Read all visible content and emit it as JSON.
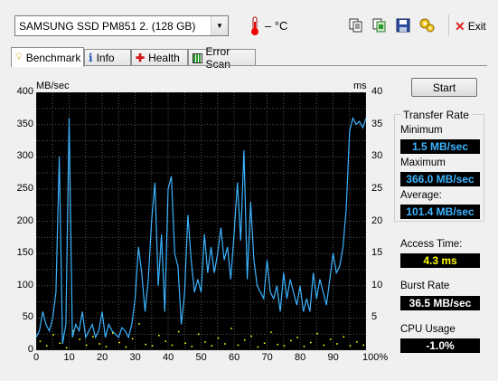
{
  "toolbar": {
    "drive": "SAMSUNG SSD PM851 2. (128 GB)",
    "temperature": "– °C",
    "exit_label": "Exit"
  },
  "tabs": [
    {
      "label": "Benchmark",
      "icon": "bulb-icon",
      "active": true
    },
    {
      "label": "Info",
      "icon": "info-icon",
      "active": false
    },
    {
      "label": "Health",
      "icon": "health-cross-icon",
      "active": false
    },
    {
      "label": "Error Scan",
      "icon": "error-scan-icon",
      "active": false
    }
  ],
  "start_label": "Start",
  "transfer_rate": {
    "title": "Transfer Rate",
    "minimum_label": "Minimum",
    "minimum": "1.5 MB/sec",
    "maximum_label": "Maximum",
    "maximum": "366.0 MB/sec",
    "average_label": "Average:",
    "average": "101.4 MB/sec"
  },
  "access_time": {
    "label": "Access Time:",
    "value": "4.3 ms"
  },
  "burst_rate": {
    "label": "Burst Rate",
    "value": "36.5 MB/sec"
  },
  "cpu_usage": {
    "label": "CPU Usage",
    "value": "-1.0%"
  },
  "colors": {
    "transfer": "#3cb4ff",
    "access": "#ffff00",
    "burst": "#ffffff",
    "cpu": "#ffffff",
    "plot_bg": "#000000"
  },
  "chart_data": {
    "type": "line",
    "ylabel_left": "MB/sec",
    "ylabel_right": "ms",
    "ylim_left": [
      0,
      400
    ],
    "ylim_right": [
      0,
      40
    ],
    "xlim": [
      0,
      100
    ],
    "x_unit": "%",
    "yticks_left": [
      "400",
      "350",
      "300",
      "250",
      "200",
      "150",
      "100",
      "50",
      "0"
    ],
    "yticks_right": [
      "40",
      "35",
      "30",
      "25",
      "20",
      "15",
      "10",
      "5"
    ],
    "xticks": [
      "0",
      "10",
      "20",
      "30",
      "40",
      "50",
      "60",
      "70",
      "80",
      "90",
      "100%"
    ],
    "grid": true,
    "series": [
      {
        "name": "Transfer Rate",
        "axis": "left",
        "x": [
          0,
          1,
          2,
          3,
          4,
          5,
          6,
          7,
          8,
          9,
          10,
          11,
          12,
          13,
          14,
          15,
          16,
          17,
          18,
          19,
          20,
          21,
          22,
          23,
          24,
          25,
          26,
          27,
          28,
          29,
          30,
          31,
          32,
          33,
          34,
          35,
          36,
          37,
          38,
          39,
          40,
          41,
          42,
          43,
          44,
          45,
          46,
          47,
          48,
          49,
          50,
          51,
          52,
          53,
          54,
          55,
          56,
          57,
          58,
          59,
          60,
          61,
          62,
          63,
          64,
          65,
          66,
          67,
          68,
          69,
          70,
          71,
          72,
          73,
          74,
          75,
          76,
          77,
          78,
          79,
          80,
          81,
          82,
          83,
          84,
          85,
          86,
          87,
          88,
          89,
          90,
          91,
          92,
          93,
          94,
          95,
          96,
          97,
          98,
          99,
          100
        ],
        "y": [
          20,
          30,
          60,
          40,
          30,
          50,
          90,
          300,
          10,
          40,
          360,
          20,
          40,
          30,
          60,
          20,
          30,
          40,
          20,
          30,
          60,
          20,
          40,
          30,
          25,
          20,
          35,
          30,
          20,
          40,
          80,
          160,
          120,
          60,
          110,
          200,
          260,
          100,
          180,
          60,
          250,
          270,
          150,
          130,
          40,
          90,
          210,
          140,
          90,
          110,
          90,
          180,
          120,
          160,
          120,
          150,
          190,
          140,
          160,
          110,
          180,
          260,
          170,
          310,
          110,
          230,
          140,
          100,
          90,
          80,
          140,
          90,
          80,
          100,
          60,
          120,
          80,
          110,
          90,
          70,
          100,
          60,
          80,
          60,
          120,
          80,
          110,
          90,
          70,
          110,
          150,
          120,
          130,
          160,
          220,
          340,
          360,
          350,
          355,
          345,
          360
        ]
      },
      {
        "name": "Access Time",
        "axis": "right",
        "style": "dots",
        "x": [
          1,
          3,
          5,
          7,
          9,
          11,
          13,
          15,
          17,
          19,
          21,
          23,
          25,
          27,
          29,
          31,
          33,
          35,
          37,
          39,
          41,
          43,
          45,
          47,
          49,
          51,
          53,
          55,
          57,
          59,
          61,
          63,
          65,
          67,
          69,
          71,
          73,
          75,
          77,
          79,
          81,
          83,
          85,
          87,
          89,
          91,
          93,
          95,
          97,
          99
        ],
        "y": [
          1.5,
          0.8,
          2.5,
          1.2,
          0.5,
          3.1,
          1.8,
          0.9,
          2.2,
          1.1,
          0.7,
          2.8,
          1.3,
          0.6,
          1.9,
          4.2,
          1.0,
          0.8,
          2.4,
          1.5,
          0.9,
          3.0,
          1.2,
          0.7,
          2.6,
          1.4,
          0.8,
          2.0,
          1.1,
          3.5,
          0.9,
          1.7,
          2.3,
          0.6,
          1.2,
          2.9,
          1.0,
          0.8,
          1.6,
          2.1,
          0.7,
          1.3,
          2.7,
          0.9,
          1.8,
          1.1,
          2.2,
          0.8,
          1.4,
          0.9
        ]
      }
    ]
  }
}
